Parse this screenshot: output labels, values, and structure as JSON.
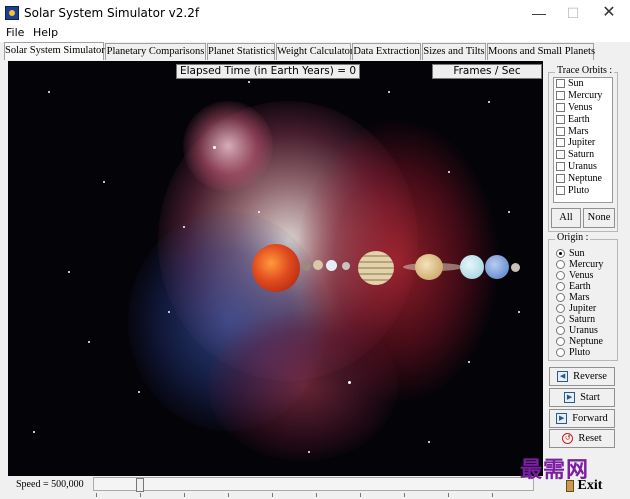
{
  "window": {
    "title": "Solar System Simulator v2.2f",
    "controls": {
      "minimize": "—",
      "maximize": "☐",
      "close": "✕"
    }
  },
  "menu": [
    "File",
    "Help"
  ],
  "tabs": [
    "Solar System Simulator",
    "Planetary Comparisons",
    "Planet Statistics",
    "Weight Calculator",
    "Data Extraction",
    "Sizes and Tilts",
    "Moons and Small Planets"
  ],
  "simulation": {
    "elapsed_label": "Elapsed Time (in Earth Years) = 0",
    "fps_label": "Frames / Sec"
  },
  "trace_orbits": {
    "title": "Trace Orbits :",
    "items": [
      "Sun",
      "Mercury",
      "Venus",
      "Earth",
      "Mars",
      "Jupiter",
      "Saturn",
      "Uranus",
      "Neptune",
      "Pluto"
    ],
    "all_label": "All",
    "none_label": "None"
  },
  "origin": {
    "title": "Origin :",
    "items": [
      "Sun",
      "Mercury",
      "Venus",
      "Earth",
      "Mars",
      "Jupiter",
      "Saturn",
      "Uranus",
      "Neptune",
      "Pluto"
    ],
    "selected": "Sun"
  },
  "controls": {
    "reverse": "Reverse",
    "start": "Start",
    "forward": "Forward",
    "reset": "Reset"
  },
  "speed_label": "Speed = 500,000",
  "exit_label": "Exit",
  "watermark": "最需网",
  "colors": {
    "sun": "#d8401f",
    "jupiter": "#d9c49a",
    "uranus": "#bfe3ee",
    "neptune": "#7fa6d8"
  }
}
